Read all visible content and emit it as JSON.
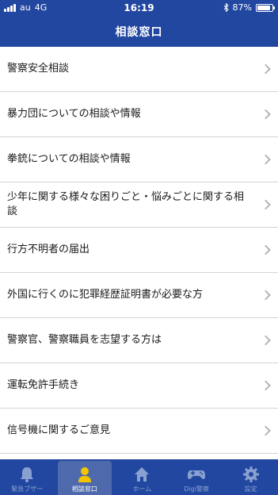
{
  "status": {
    "carrier": "au",
    "network": "4G",
    "time": "16:19",
    "battery": "87%",
    "battery_level": 0.87
  },
  "header": {
    "title": "相談窓口"
  },
  "items": [
    {
      "label": "警察安全相談"
    },
    {
      "label": "暴力団についての相談や情報"
    },
    {
      "label": "拳銃についての相談や情報"
    },
    {
      "label": "少年に関する様々な困りごと・悩みごとに関する相談"
    },
    {
      "label": "行方不明者の届出"
    },
    {
      "label": "外国に行くのに犯罪経歴証明書が必要な方"
    },
    {
      "label": "警察官、警察職員を志望する方は"
    },
    {
      "label": "運転免許手続き"
    },
    {
      "label": "信号機に関するご意見"
    }
  ],
  "tabs": [
    {
      "label": "緊急ブザー",
      "icon": "bell-icon"
    },
    {
      "label": "相談窓口",
      "icon": "person-icon",
      "active": true
    },
    {
      "label": "ホーム",
      "icon": "home-icon"
    },
    {
      "label": "Digi警察",
      "icon": "gamepad-icon"
    },
    {
      "label": "設定",
      "icon": "gear-icon"
    }
  ],
  "colors": {
    "header": "#2247a0",
    "tab_active": "#4e6aac",
    "divider": "#d4d4d4",
    "chevron": "#b5b5b5"
  }
}
